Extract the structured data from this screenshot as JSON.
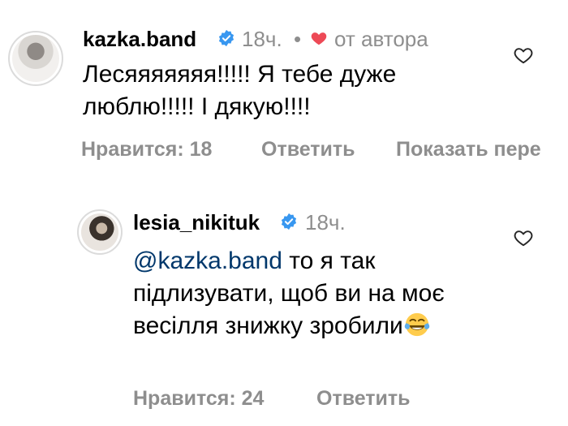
{
  "comments": [
    {
      "username": "kazka.band",
      "time": "18ч.",
      "separator": "•",
      "author_label": "от автора",
      "text": "Лесяяяяяяя!!!!! Я тебе дуже люблю!!!!! І дякую!!!!",
      "likes_label": "Нравится: 18",
      "reply_label": "Ответить",
      "translate_label": "Показать пере"
    },
    {
      "username": "lesia_nikituk",
      "time": "18ч.",
      "mention": "@kazka.band",
      "text": " то я так підлизувати, щоб ви на моє весілля знижку зробили",
      "emoji": "face-with-tears-of-joy",
      "likes_label": "Нравится: 24",
      "reply_label": "Ответить"
    }
  ],
  "colors": {
    "secondary_text": "#8e8e8e",
    "verified_blue": "#3897f0",
    "heart_red": "#ed4956",
    "mention_link": "#00376b"
  }
}
